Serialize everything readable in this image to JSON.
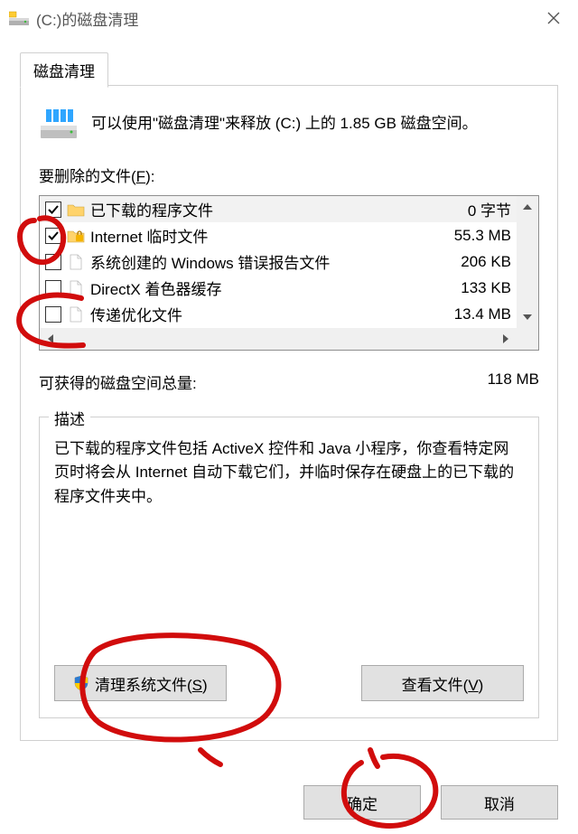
{
  "titlebar": {
    "title": "(C:)的磁盘清理"
  },
  "tab": {
    "label_diskcleanup": "磁盘清理"
  },
  "intro": {
    "text": "可以使用\"磁盘清理\"来释放  (C:) 上的 1.85 GB 磁盘空间。"
  },
  "files_label_prefix": "要删除的文件(",
  "files_label_key": "F",
  "files_label_suffix": "):",
  "file_list": [
    {
      "checked": true,
      "icon": "folder",
      "name": "已下载的程序文件",
      "size": "0 字节"
    },
    {
      "checked": true,
      "icon": "lock",
      "name": "Internet 临时文件",
      "size": "55.3 MB"
    },
    {
      "checked": false,
      "icon": "file",
      "name": "系统创建的 Windows 错误报告文件",
      "size": "206 KB"
    },
    {
      "checked": false,
      "icon": "file",
      "name": "DirectX 着色器缓存",
      "size": "133 KB"
    },
    {
      "checked": false,
      "icon": "file",
      "name": "传递优化文件",
      "size": "13.4 MB"
    }
  ],
  "total": {
    "label": "可获得的磁盘空间总量:",
    "value": "118 MB"
  },
  "description": {
    "legend": "描述",
    "text": "已下载的程序文件包括 ActiveX 控件和 Java 小程序，你查看特定网页时将会从 Internet 自动下载它们，并临时保存在硬盘上的已下载的程序文件夹中。"
  },
  "buttons": {
    "clean_system_prefix": "清理系统文件(",
    "clean_system_key": "S",
    "clean_system_suffix": ")",
    "view_files_prefix": "查看文件(",
    "view_files_key": "V",
    "view_files_suffix": ")",
    "ok": "确定",
    "cancel": "取消"
  },
  "colors": {
    "annotation": "#d10c0c"
  }
}
